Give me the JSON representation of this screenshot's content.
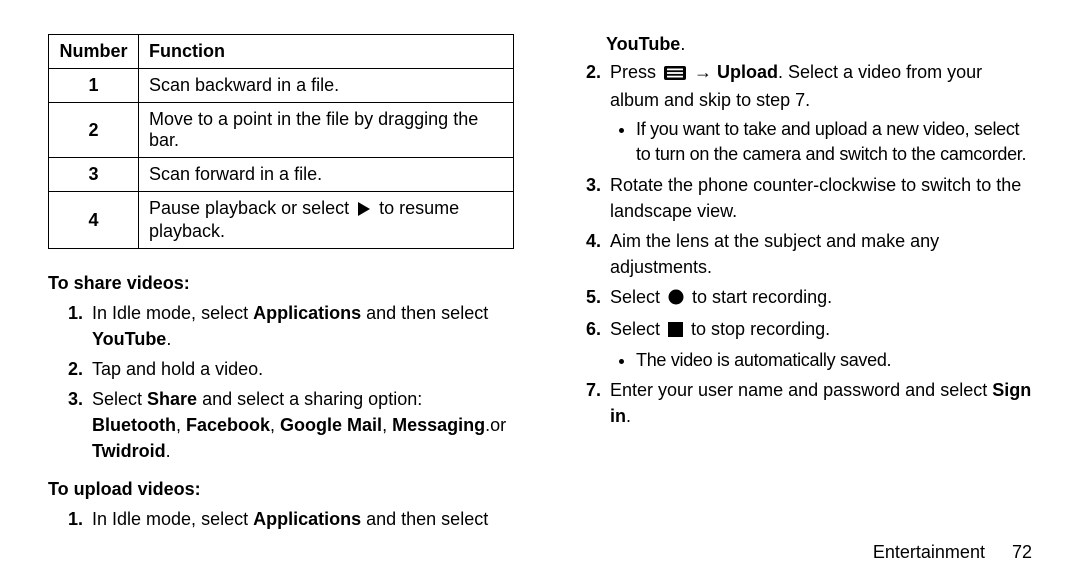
{
  "table": {
    "headers": {
      "number": "Number",
      "function": "Function"
    },
    "rows": [
      {
        "num": "1",
        "func": "Scan backward in a file."
      },
      {
        "num": "2",
        "func": "Move to a point in the file by dragging the bar."
      },
      {
        "num": "3",
        "func": "Scan forward in a file."
      },
      {
        "num": "4",
        "func_before": "Pause playback or select ",
        "func_after": " to resume playback."
      }
    ]
  },
  "share": {
    "heading": "To share videos:",
    "step1_a": "In Idle mode, select ",
    "step1_b": "Applications",
    "step1_c": " and then select ",
    "step1_d": "YouTube",
    "step1_e": ".",
    "step2": "Tap and hold a video.",
    "step3_a": "Select ",
    "step3_b": "Share",
    "step3_c": " and select a sharing option: ",
    "step3_d": "Bluetooth",
    "step3_e": ", ",
    "step3_f": "Facebook",
    "step3_g": ", ",
    "step3_h": "Google Mail",
    "step3_i": ", ",
    "step3_j": "Messaging",
    "step3_k": ".or ",
    "step3_l": "Twidroid",
    "step3_m": "."
  },
  "upload": {
    "heading": "To upload videos:",
    "step1_a": "In Idle mode, select ",
    "step1_b": "Applications",
    "step1_c": " and then select ",
    "step1_d": "YouTube",
    "step1_e": ".",
    "step2_a": "Press  ",
    "step2_b": " → ",
    "step2_c": "Upload",
    "step2_d": ". Select a video from your album and skip to step 7.",
    "step2_bullet": "If you want to take and upload a new video, select to turn on the camera and switch to the camcorder.",
    "step3": "Rotate the phone counter-clockwise to switch to the landscape view.",
    "step4": "Aim the lens at the subject and make any adjustments.",
    "step5_a": "Select ",
    "step5_b": " to start recording.",
    "step6_a": "Select ",
    "step6_b": " to stop recording.",
    "step6_bullet": "The video is automatically saved.",
    "step7_a": "Enter your user name and password and select ",
    "step7_b": "Sign in",
    "step7_c": "."
  },
  "footer": {
    "section": "Entertainment",
    "page": "72"
  }
}
